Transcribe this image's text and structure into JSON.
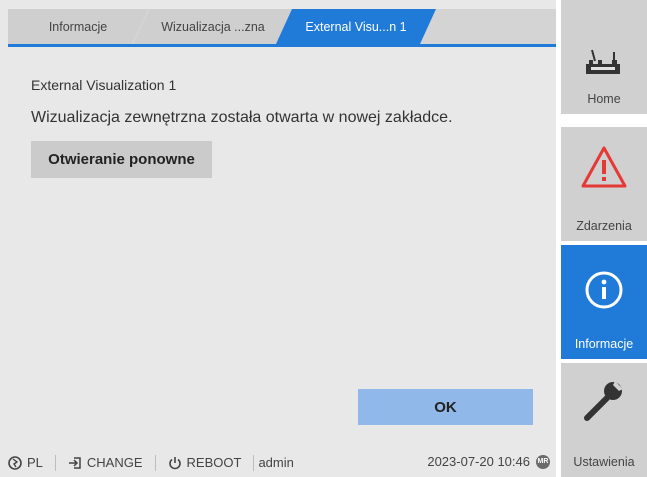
{
  "tabs": [
    {
      "label": "Informacje"
    },
    {
      "label": "Wizualizacja ...zna"
    },
    {
      "label": "External Visu...n 1"
    }
  ],
  "content": {
    "title": "External Visualization 1",
    "message": "Wizualizacja zewnętrzna została otwarta w nowej zakładce.",
    "reopen_label": "Otwieranie ponowne",
    "ok_label": "OK"
  },
  "statusbar": {
    "language": "PL",
    "change": "CHANGE",
    "reboot": "REBOOT",
    "user": "admin",
    "datetime": "2023-07-20 10:46",
    "badge": "MR"
  },
  "nav": {
    "home": "Home",
    "events": "Zdarzenia",
    "info": "Informacje",
    "settings": "Ustawienia"
  },
  "colors": {
    "accent": "#1f7ad8",
    "warning": "#e53935",
    "ok_button": "#90b8e8"
  }
}
